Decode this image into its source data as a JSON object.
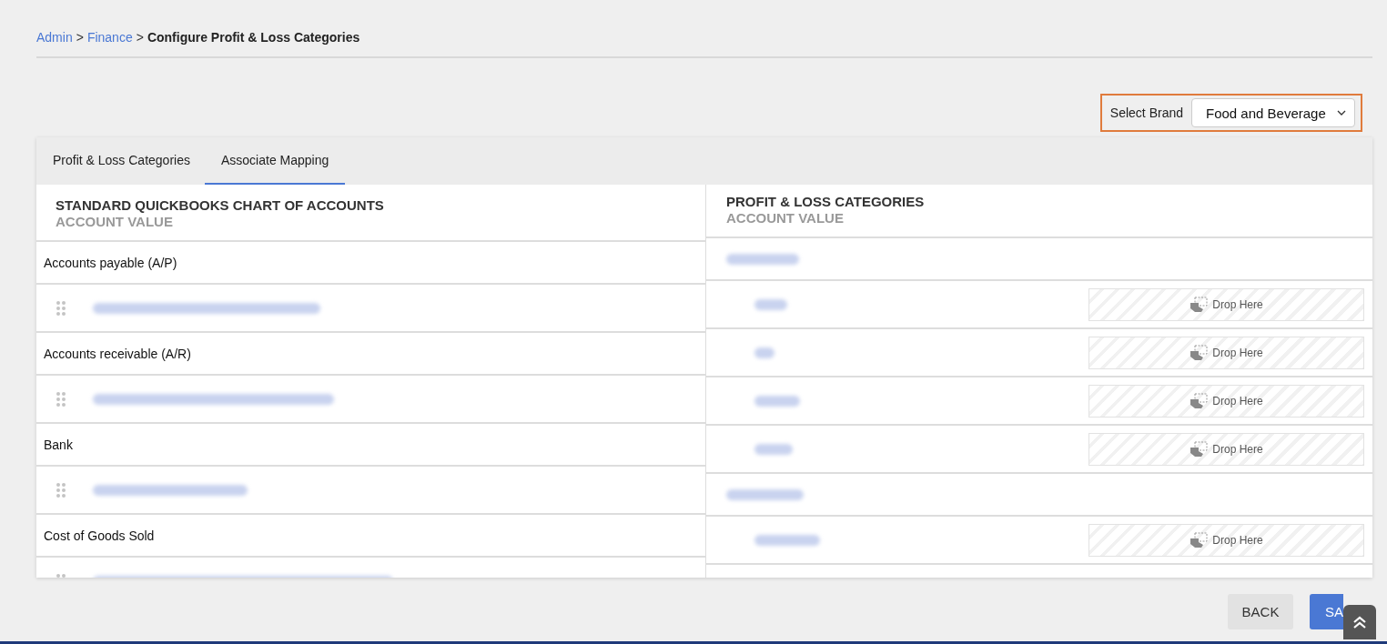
{
  "breadcrumb": [
    {
      "kind": "link",
      "text": "Admin"
    },
    {
      "kind": "separator",
      "text": ">"
    },
    {
      "kind": "link",
      "text": "Finance"
    },
    {
      "kind": "separator",
      "text": ">"
    },
    {
      "kind": "current",
      "text": "Configure Profit & Loss Categories"
    }
  ],
  "brand": {
    "label": "Select Brand",
    "value": "Food and Beverage"
  },
  "tabs": [
    {
      "label": "Profit & Loss Categories",
      "selected": false
    },
    {
      "label": "Associate Mapping",
      "selected": true
    }
  ],
  "left": {
    "title": "STANDARD QUICKBOOKS CHART OF ACCOUNTS",
    "subtitle": "ACCOUNT VALUE",
    "groups": [
      {
        "name": "Accounts payable (A/P)"
      },
      {
        "name": "Accounts receivable (A/R)"
      },
      {
        "name": "Bank"
      },
      {
        "name": "Cost of Goods Sold"
      }
    ]
  },
  "right": {
    "title": "PROFIT & LOSS CATEGORIES",
    "subtitle": "ACCOUNT VALUE",
    "groups": [
      {
        "rows": [
          {
            "drop_label": "Drop Here"
          },
          {
            "drop_label": "Drop Here"
          },
          {
            "drop_label": "Drop Here"
          },
          {
            "drop_label": "Drop Here"
          }
        ]
      },
      {
        "rows": [
          {
            "drop_label": "Drop Here"
          }
        ]
      }
    ]
  },
  "buttons": {
    "back": "BACK",
    "save": "SA"
  }
}
